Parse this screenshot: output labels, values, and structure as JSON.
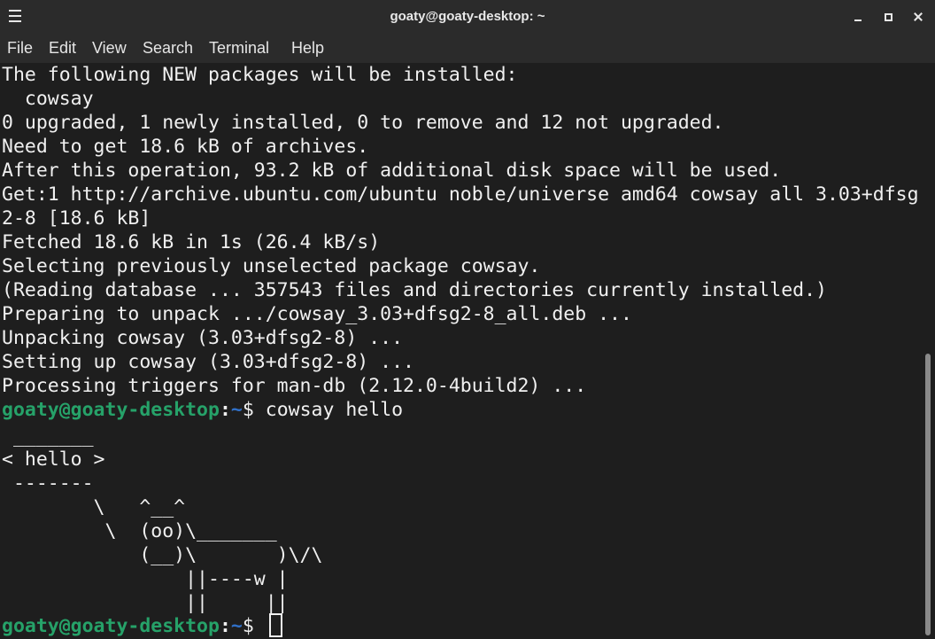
{
  "window": {
    "title": "goaty@goaty-desktop: ~"
  },
  "menu": {
    "file": "File",
    "edit": "Edit",
    "view": "View",
    "search": "Search",
    "terminal": "Terminal",
    "help": "Help"
  },
  "terminal": {
    "lines": [
      "The following NEW packages will be installed:",
      "  cowsay",
      "0 upgraded, 1 newly installed, 0 to remove and 12 not upgraded.",
      "Need to get 18.6 kB of archives.",
      "After this operation, 93.2 kB of additional disk space will be used.",
      "Get:1 http://archive.ubuntu.com/ubuntu noble/universe amd64 cowsay all 3.03+dfsg",
      "2-8 [18.6 kB]",
      "Fetched 18.6 kB in 1s (26.4 kB/s)",
      "Selecting previously unselected package cowsay.",
      "(Reading database ... 357543 files and directories currently installed.)",
      "Preparing to unpack .../cowsay_3.03+dfsg2-8_all.deb ...",
      "Unpacking cowsay (3.03+dfsg2-8) ...",
      "Setting up cowsay (3.03+dfsg2-8) ...",
      "Processing triggers for man-db (2.12.0-4build2) ..."
    ],
    "prompt": {
      "user_host": "goaty@goaty-desktop",
      "separator": ":",
      "dir": "~",
      "symbol": "$ "
    },
    "command1": "cowsay hello",
    "cow": [
      " _______",
      "< hello >",
      " -------",
      "        \\   ^__^",
      "         \\  (oo)\\_______",
      "            (__)\\       )\\/\\",
      "                ||----w |",
      "                ||     ||"
    ],
    "command2": ""
  },
  "colors": {
    "background": "#1e1e1e",
    "foreground": "#f0f0f0",
    "prompt_user": "#26a269",
    "prompt_dir": "#3070c8",
    "chrome": "#2b2b2b"
  }
}
